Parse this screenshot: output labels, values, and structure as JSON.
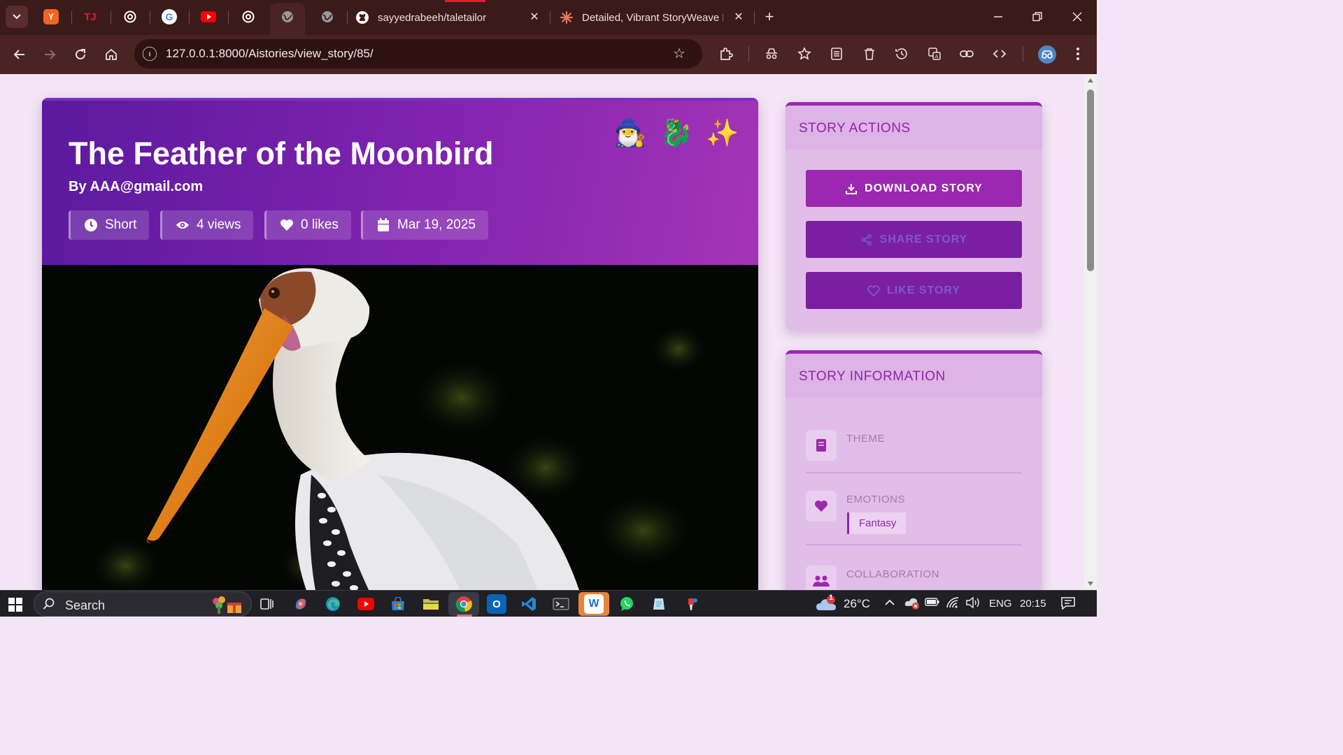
{
  "browser": {
    "tabs": [
      {
        "title": "sayyedrabeeh/taletailor",
        "icon": "github-icon"
      },
      {
        "title": "Detailed, Vibrant StoryWeave R",
        "icon": "claude-icon"
      }
    ],
    "pinned_tabs": [
      "y-combinator-icon",
      "tj-icon",
      "chatgpt-icon",
      "google-icon",
      "youtube-icon",
      "chatgpt-icon",
      "globe-icon",
      "globe-icon"
    ],
    "url": "127.0.0.1:8000/Aistories/view_story/85/"
  },
  "story": {
    "title": "The Feather of the Moonbird",
    "author": "By AAA@gmail.com",
    "emojis": [
      "🧙‍♂️",
      "🐉",
      "✨"
    ],
    "meta": {
      "length": "Short",
      "views": "4 views",
      "likes": "0 likes",
      "date": "Mar 19, 2025"
    }
  },
  "actions": {
    "heading": "STORY ACTIONS",
    "download": "DOWNLOAD STORY",
    "share": "SHARE STORY",
    "like": "LIKE STORY"
  },
  "info": {
    "heading": "STORY INFORMATION",
    "theme_label": "THEME",
    "emotions_label": "EMOTIONS",
    "emotions_value": "Fantasy",
    "collaboration_label": "COLLABORATION"
  },
  "taskbar": {
    "search": "Search",
    "temperature": "26°C",
    "weather_badge": "1",
    "language": "ENG",
    "time": "20:15"
  },
  "colors": {
    "hero_gradient_start": "#5b1a9e",
    "hero_gradient_end": "#a434b6",
    "accent": "#9c27b0",
    "page_bg": "#f3e5f5",
    "browser_frame": "#3b1a1a"
  }
}
